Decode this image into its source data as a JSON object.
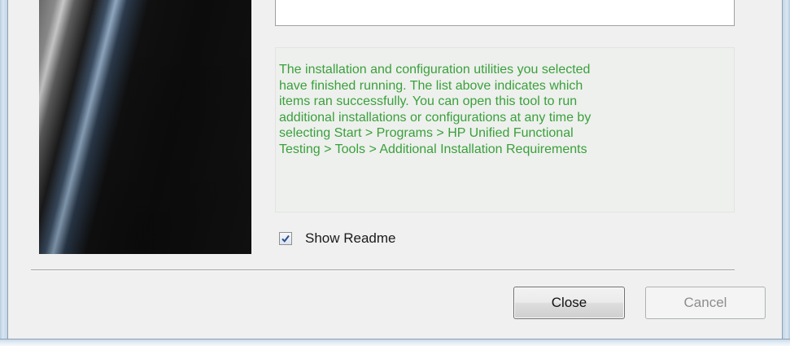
{
  "message": {
    "text": "The installation and configuration utilities you selected\nhave finished running. The list above indicates which\nitems ran successfully.  You can open this tool to run\nadditional installations or configurations at any time by\nselecting Start > Programs > HP Unified Functional\nTesting > Tools > Additional Installation Requirements",
    "color": "#3aa03c"
  },
  "options": {
    "show_readme_label": "Show Readme",
    "show_readme_checked": true
  },
  "buttons": {
    "close_label": "Close",
    "cancel_label": "Cancel",
    "cancel_enabled": false
  }
}
